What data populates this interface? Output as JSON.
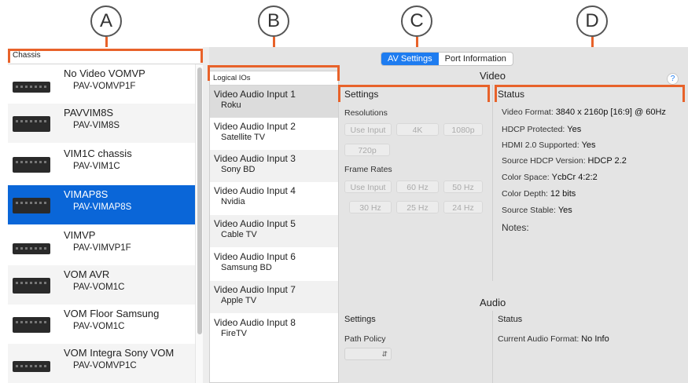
{
  "callouts": [
    "A",
    "B",
    "C",
    "D"
  ],
  "accent_color": "#e8622a",
  "selection_color": "#0a66d8",
  "chassis": {
    "header": "Chassis",
    "items": [
      {
        "name": "No Video VOMVP",
        "model": "PAV-VOMVP1F"
      },
      {
        "name": "PAVVIM8S",
        "model": "PAV-VIM8S"
      },
      {
        "name": "VIM1C chassis",
        "model": "PAV-VIM1C"
      },
      {
        "name": "VIMAP8S",
        "model": "PAV-VIMAP8S",
        "selected": true
      },
      {
        "name": "VIMVP",
        "model": "PAV-VIMVP1F"
      },
      {
        "name": "VOM AVR",
        "model": "PAV-VOM1C"
      },
      {
        "name": "VOM Floor Samsung",
        "model": "PAV-VOM1C"
      },
      {
        "name": "VOM Integra Sony VOM",
        "model": "PAV-VOMVP1C"
      }
    ]
  },
  "tabs": [
    "AV Settings",
    "Port Information"
  ],
  "logical": {
    "header": "Logical IOs",
    "items": [
      {
        "name": "Video Audio Input 1",
        "source": "Roku"
      },
      {
        "name": "Video Audio Input 2",
        "source": "Satellite TV"
      },
      {
        "name": "Video Audio Input 3",
        "source": "Sony BD"
      },
      {
        "name": "Video Audio Input 4",
        "source": "Nvidia"
      },
      {
        "name": "Video Audio Input 5",
        "source": "Cable TV"
      },
      {
        "name": "Video Audio Input 6",
        "source": "Samsung BD"
      },
      {
        "name": "Video Audio Input 7",
        "source": "Apple TV"
      },
      {
        "name": "Video Audio Input 8",
        "source": "FireTV"
      }
    ]
  },
  "video": {
    "title": "Video",
    "help": "?",
    "settings": {
      "title": "Settings",
      "resolutions_label": "Resolutions",
      "resolutions": [
        "Use Input",
        "4K",
        "1080p",
        "720p"
      ],
      "frame_rates_label": "Frame Rates",
      "frame_rates": [
        "Use Input",
        "60 Hz",
        "50 Hz",
        "30 Hz",
        "25 Hz",
        "24 Hz"
      ]
    },
    "status": {
      "title": "Status",
      "video_format_label": "Video Format:",
      "video_format": "3840 x 2160p [16:9] @ 60Hz",
      "hdcp_label": "HDCP Protected:",
      "hdcp": "Yes",
      "hdmi_label": "HDMI 2.0 Supported:",
      "hdmi": "Yes",
      "source_hdcp_label": "Source HDCP Version:",
      "source_hdcp": "HDCP 2.2",
      "color_space_label": "Color Space:",
      "color_space": "YcbCr 4:2:2",
      "color_depth_label": "Color Depth:",
      "color_depth": "12 bits",
      "source_stable_label": "Source Stable:",
      "source_stable": "Yes",
      "notes_label": "Notes:"
    }
  },
  "audio": {
    "title": "Audio",
    "settings_title": "Settings",
    "path_policy_label": "Path Policy",
    "status_title": "Status",
    "current_format_label": "Current Audio Format:",
    "current_format": "No Info"
  }
}
